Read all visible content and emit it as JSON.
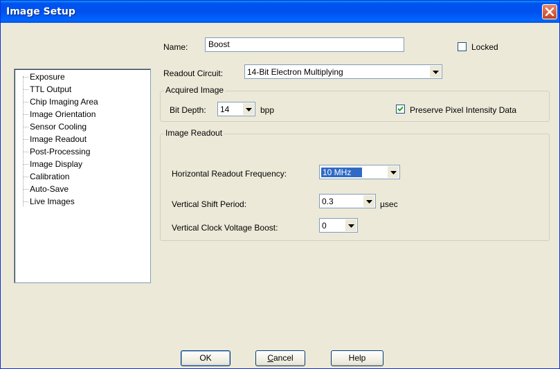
{
  "window": {
    "title": "Image Setup"
  },
  "name": {
    "label": "Name:",
    "value": "Boost"
  },
  "locked": {
    "label": "Locked",
    "checked": false
  },
  "readout_circuit": {
    "label": "Readout Circuit:",
    "value": "14-Bit Electron Multiplying"
  },
  "acquired_image": {
    "title": "Acquired Image",
    "bit_depth_label": "Bit Depth:",
    "bit_depth_value": "14",
    "bit_depth_unit": "bpp",
    "preserve_label": "Preserve Pixel Intensity Data",
    "preserve_checked": true
  },
  "image_readout": {
    "title": "Image Readout",
    "horizontal_label": "Horizontal Readout Frequency:",
    "horizontal_value": "10 MHz",
    "vertical_shift_label": "Vertical Shift Period:",
    "vertical_shift_value": "0.3",
    "vertical_shift_unit": "µsec",
    "vertical_clock_label": "Vertical Clock Voltage Boost:",
    "vertical_clock_value": "0"
  },
  "tree": {
    "items": [
      "Exposure",
      "TTL Output",
      "Chip Imaging Area",
      "Image Orientation",
      "Sensor Cooling",
      "Image Readout",
      "Post-Processing",
      "Image Display",
      "Calibration",
      "Auto-Save",
      "Live Images"
    ]
  },
  "buttons": {
    "ok": "OK",
    "cancel_first": "C",
    "cancel_rest": "ancel",
    "help": "Help"
  },
  "icons": {
    "close": "close-icon",
    "dropdown": "chevron-down-icon",
    "check": "checkmark-icon"
  },
  "colors": {
    "titlebar": "#0054e3",
    "dialog_bg": "#ece9d8",
    "selection": "#316ac5",
    "close": "#c6401e"
  }
}
